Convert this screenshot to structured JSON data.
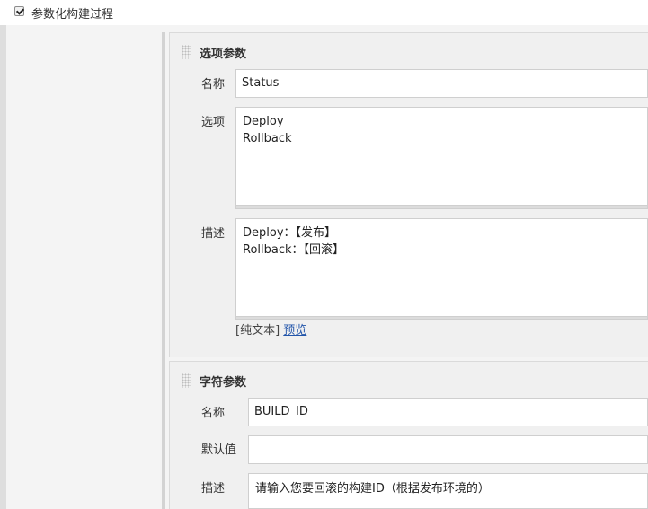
{
  "top": {
    "checkbox_checked": true,
    "label": "参数化构建过程"
  },
  "choice_param": {
    "title": "选项参数",
    "name_label": "名称",
    "name_value": "Status",
    "choices_label": "选项",
    "choices": [
      "Deploy",
      "Rollback"
    ],
    "desc_label": "描述",
    "desc_lines": [
      "Deploy：【发布】",
      "Rollback：【回滚】"
    ],
    "plain_text": "[纯文本]",
    "preview": "预览"
  },
  "string_param": {
    "title": "字符参数",
    "name_label": "名称",
    "name_value": "BUILD_ID",
    "default_label": "默认值",
    "default_value": "",
    "desc_label": "描述",
    "desc_value": "请输入您要回滚的构建ID（根据发布环境的）"
  }
}
